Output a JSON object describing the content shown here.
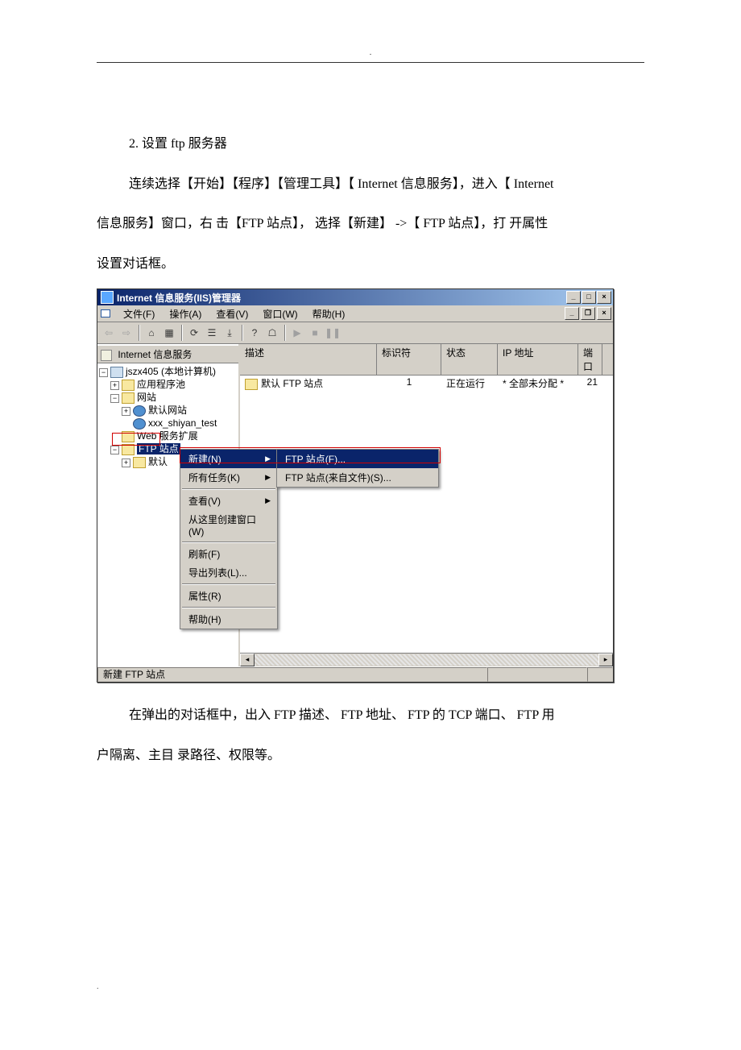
{
  "doc": {
    "step_title": "2.  设置 ftp 服务器",
    "p1": "连续选择【开始】【程序】【管理工具】【 Internet 信息服务】，进入【 Internet",
    "p2": "信息服务】窗口，右 击【FTP 站点】， 选择【新建】 ->【 FTP 站点】，打 开属性",
    "p3": "设置对话框。",
    "p4": "在弹出的对话框中，出入 FTP 描述、 FTP 地址、 FTP 的 TCP 端口、 FTP 用",
    "p5": "户隔离、主目 录路径、权限等。"
  },
  "window": {
    "title": "Internet 信息服务(IIS)管理器",
    "menus": [
      "文件(F)",
      "操作(A)",
      "查看(V)",
      "窗口(W)",
      "帮助(H)"
    ],
    "tree_header": "Internet 信息服务",
    "tree": {
      "root": "jszx405 (本地计算机)",
      "app_pool": "应用程序池",
      "sites": "网站",
      "default_site": "默认网站",
      "xxx": "xxx_shiyan_test",
      "web_ext": "Web 服务扩展",
      "ftp_sites": "FTP 站点",
      "ftp_default": "默认"
    },
    "list": {
      "headers": {
        "desc": "描述",
        "id": "标识符",
        "status": "状态",
        "ip": "IP 地址",
        "port": "端口"
      },
      "row": {
        "desc": "默认 FTP 站点",
        "id": "1",
        "status": "正在运行",
        "ip": "* 全部未分配 *",
        "port": "21"
      }
    },
    "ctxmenu": {
      "new": "新建(N)",
      "tasks": "所有任务(K)",
      "view": "查看(V)",
      "newwin": "从这里创建窗口(W)",
      "refresh": "刷新(F)",
      "export": "导出列表(L)...",
      "props": "属性(R)",
      "help": "帮助(H)"
    },
    "submenu": {
      "ftp_site": "FTP 站点(F)...",
      "ftp_site_file": "FTP 站点(来自文件)(S)..."
    },
    "statusbar": "新建 FTP 站点"
  }
}
